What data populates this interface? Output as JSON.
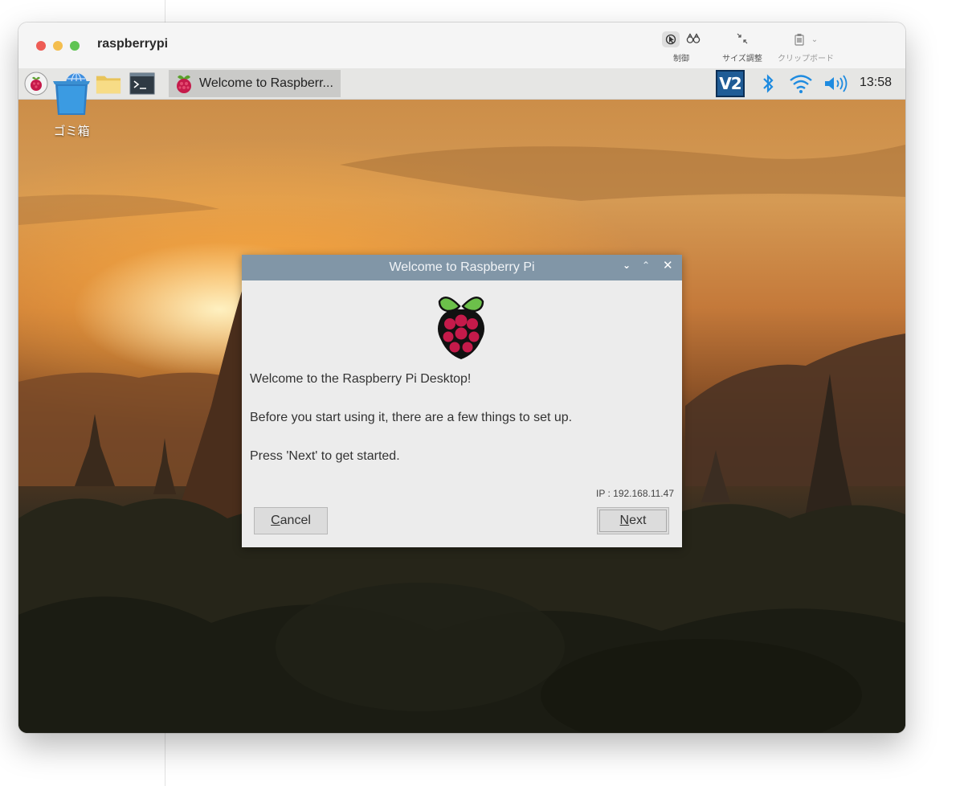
{
  "window": {
    "title": "raspberrypi"
  },
  "toolbar": {
    "control_label": "制御",
    "resize_label": "サイズ調整",
    "clipboard_label": "クリップボード"
  },
  "taskbar": {
    "active_task": "Welcome to Raspberr...",
    "vnc_label": "V2",
    "clock": "13:58"
  },
  "desktop": {
    "trash_label": "ゴミ箱"
  },
  "dialog": {
    "title": "Welcome to Raspberry Pi",
    "line1": "Welcome to the Raspberry Pi Desktop!",
    "line2": "Before you start using it, there are a few things to set up.",
    "line3": "Press 'Next' to get started.",
    "ip": "IP : 192.168.11.47",
    "cancel_first": "C",
    "cancel_rest": "ancel",
    "next_first": "N",
    "next_rest": "ext"
  },
  "colors": {
    "dialog_titlebar": "#8196a7",
    "taskbar": "#e6e6e4",
    "vnc_badge": "#1f5c96",
    "tray_blue": "#1e8be0",
    "traffic_red": "#ee5c55",
    "traffic_yellow": "#f4be4e",
    "traffic_green": "#5fc453"
  }
}
